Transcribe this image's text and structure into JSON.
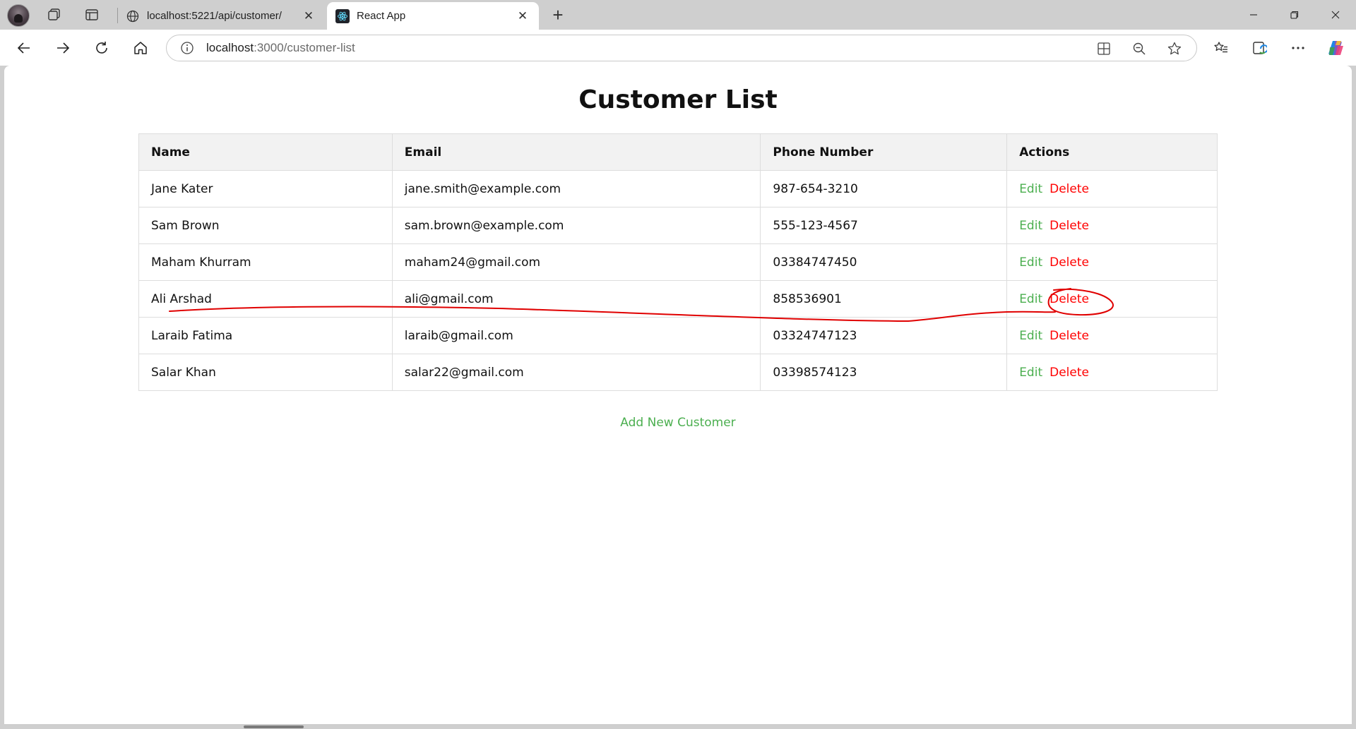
{
  "browser": {
    "tabs": [
      {
        "title": "localhost:5221/api/customer/",
        "active": false,
        "icon": "globe-icon"
      },
      {
        "title": "React App",
        "active": true,
        "icon": "react-icon"
      }
    ],
    "address": {
      "host": "localhost",
      "path": ":3000/customer-list"
    },
    "window_controls": [
      "minimize",
      "restore",
      "close"
    ]
  },
  "page": {
    "title": "Customer List",
    "table": {
      "headers": {
        "name": "Name",
        "email": "Email",
        "phone": "Phone Number",
        "actions": "Actions"
      },
      "rows": [
        {
          "name": "Jane Kater",
          "email": "jane.smith@example.com",
          "phone": "987-654-3210",
          "edit": "Edit",
          "delete": "Delete"
        },
        {
          "name": "Sam Brown",
          "email": "sam.brown@example.com",
          "phone": "555-123-4567",
          "edit": "Edit",
          "delete": "Delete"
        },
        {
          "name": "Maham Khurram",
          "email": "maham24@gmail.com",
          "phone": "03384747450",
          "edit": "Edit",
          "delete": "Delete"
        },
        {
          "name": "Ali Arshad",
          "email": "ali@gmail.com",
          "phone": "858536901",
          "edit": "Edit",
          "delete": "Delete"
        },
        {
          "name": "Laraib Fatima",
          "email": "laraib@gmail.com",
          "phone": "03324747123",
          "edit": "Edit",
          "delete": "Delete"
        },
        {
          "name": "Salar Khan",
          "email": "salar22@gmail.com",
          "phone": "03398574123",
          "edit": "Edit",
          "delete": "Delete"
        }
      ]
    },
    "add_link": "Add New Customer"
  },
  "colors": {
    "edit": "#4caf50",
    "delete": "#ff0000",
    "annotation": "#e00000",
    "header_bg": "#f2f2f2"
  }
}
